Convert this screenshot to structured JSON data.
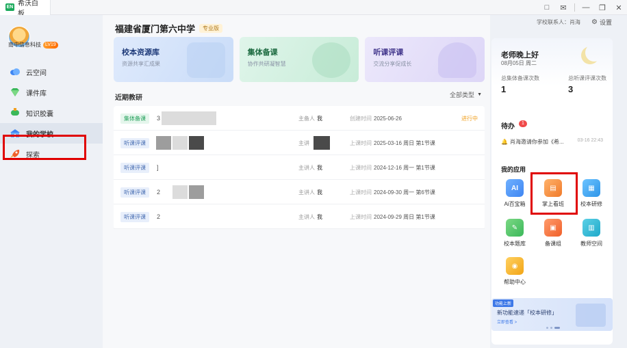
{
  "window": {
    "app_name": "希沃白板",
    "app_logo": "EN",
    "controls": [
      "□",
      "✉",
      "—",
      "❐",
      "✕"
    ]
  },
  "profile": {
    "org": "南中信息科技",
    "level": "LV19"
  },
  "sidebar": {
    "items": [
      {
        "label": "云空间",
        "icon": "cloud-icon"
      },
      {
        "label": "课件库",
        "icon": "diamond-icon"
      },
      {
        "label": "知识胶囊",
        "icon": "capsule-icon"
      },
      {
        "label": "我的学校",
        "icon": "school-icon"
      },
      {
        "label": "探索",
        "icon": "rocket-icon"
      }
    ]
  },
  "header": {
    "school_name": "福建省厦门第六中学",
    "plan_badge": "专业版",
    "contact": "学校联系人：肖海",
    "settings": "设置"
  },
  "cards": [
    {
      "title": "校本资源库",
      "subtitle": "资源共享汇成果"
    },
    {
      "title": "集体备课",
      "subtitle": "协作共研凝智慧"
    },
    {
      "title": "听课评课",
      "subtitle": "交流分享促成长"
    }
  ],
  "recent": {
    "title": "近期教研",
    "filter": "全部类型",
    "rows": [
      {
        "tag": "集体备课",
        "tag_color": "green",
        "title": "3",
        "owner_label": "主备人",
        "owner": "我",
        "time_label": "创建时间",
        "time": "2025-06-26",
        "status": "进行中"
      },
      {
        "tag": "听课评课",
        "tag_color": "blue",
        "title": "",
        "owner_label": "主讲",
        "owner": "",
        "time_label": "上课时间",
        "time": "2025-03-16 周日 第1节课",
        "status": ""
      },
      {
        "tag": "听课评课",
        "tag_color": "blue",
        "title": "]",
        "owner_label": "主讲人",
        "owner": "我",
        "time_label": "上课时间",
        "time": "2024-12-16 周一 第1节课",
        "status": ""
      },
      {
        "tag": "听课评课",
        "tag_color": "blue",
        "title": "2",
        "owner_label": "主讲人",
        "owner": "我",
        "time_label": "上课时间",
        "time": "2024-09-30 周一 第6节课",
        "status": ""
      },
      {
        "tag": "听课评课",
        "tag_color": "blue",
        "title": "2",
        "owner_label": "主讲人",
        "owner": "我",
        "time_label": "上课时间",
        "time": "2024-09-29 周日 第1节课",
        "status": ""
      }
    ]
  },
  "panel": {
    "greeting": "老师晚上好",
    "date": "08月05日 周二",
    "stat1_label": "总集体备课次数",
    "stat1_value": "1",
    "stat2_label": "总听课评课次数",
    "stat2_value": "3",
    "todo_title": "待办",
    "todo_count": "1",
    "todo_text": "肖海邀请你参加《希...",
    "todo_time": "03-16 22:43",
    "apps_title": "我的应用",
    "apps": [
      {
        "label": "Ai百宝箱",
        "icon": "ai-icon",
        "glyph": "AI"
      },
      {
        "label": "掌上看班",
        "icon": "class-monitor-icon",
        "glyph": "▤"
      },
      {
        "label": "校本研修",
        "icon": "study-icon",
        "glyph": "▦"
      },
      {
        "label": "校本题库",
        "icon": "question-bank-icon",
        "glyph": "✎"
      },
      {
        "label": "备课组",
        "icon": "prep-group-icon",
        "glyph": "▣"
      },
      {
        "label": "教师空间",
        "icon": "teacher-space-icon",
        "glyph": "▥"
      },
      {
        "label": "帮助中心",
        "icon": "help-icon",
        "glyph": "◉"
      }
    ],
    "promo_tag": "功能上新",
    "promo_text": "新功能速递「校本研修」",
    "promo_link": "立即查看 >"
  },
  "colors": {
    "accent": "#3d78e8",
    "highlight": "#e00000",
    "status": "#f0a020"
  }
}
